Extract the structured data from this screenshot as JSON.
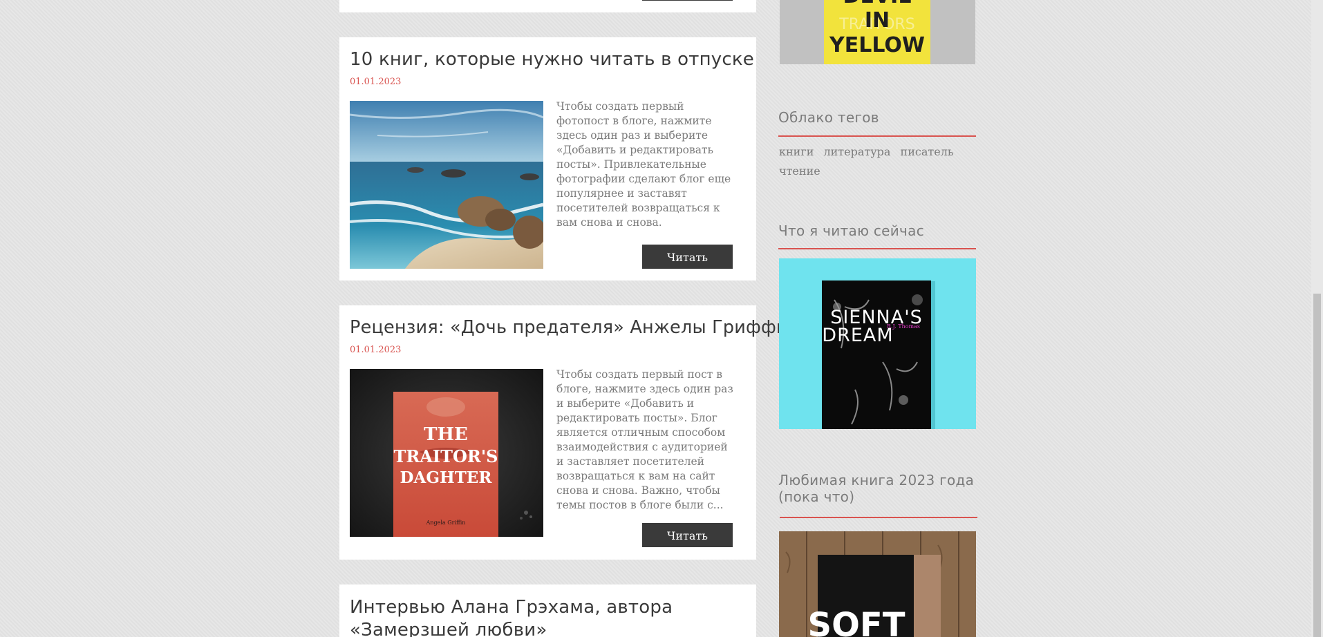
{
  "posts": [
    {
      "title": "10 книг, которые нужно читать в отпуске",
      "date": "01.01.2023",
      "excerpt": "Чтобы создать первый фотопост в блоге, нажмите здесь один раз и выберите «Добавить и редактировать посты». Привлекательные фотографии сделают блог еще популярнее и заставят посетителей возвращаться к вам снова и снова.",
      "read_label": "Читать"
    },
    {
      "title": "Рецензия: «Дочь предателя» Анжелы Гриффин",
      "date": "01.01.2023",
      "excerpt": "Чтобы создать первый пост в блоге, нажмите здесь один раз и выберите «Добавить и редактировать посты». Блог является отличным способом взаимодействия с аудиторией и заставляет посетителей возвращаться к вам на сайт снова и снова. Важно, чтобы темы постов в блоге были с...",
      "read_label": "Читать",
      "cover": {
        "title_line1": "THE",
        "title_line2": "TRAITOR'S",
        "title_line3": "DAGHTER",
        "author": "Angela Griffin"
      }
    },
    {
      "title": "Интервью Алана Грэхама, автора «Замерзшей любви»"
    }
  ],
  "sidebar": {
    "top_cover": {
      "line1": "DEVIL",
      "line2": "IN",
      "line3": "YELLOW",
      "watermark": "TRAITORS"
    },
    "tag_cloud": {
      "title": "Облако тегов",
      "tags": [
        "книги",
        "литература",
        "писатель",
        "чтение"
      ]
    },
    "reading_now": {
      "title": "Что я читаю сейчас",
      "cover": {
        "line1": "SIENNA'S",
        "line2": "DREAM",
        "author": "R.J. Thomas"
      }
    },
    "favorite_book": {
      "title_line1": "Любимая книга 2023 года",
      "title_line2": "(пока что)",
      "cover": {
        "line1": "SOFT"
      }
    }
  },
  "colors": {
    "accent": "#d9534f",
    "button_bg": "#3a3a3a",
    "card_bg": "#ffffff",
    "page_bg": "#e4e4e4",
    "muted_text": "#7b7b7b",
    "heading_text": "#3a3a3a"
  }
}
